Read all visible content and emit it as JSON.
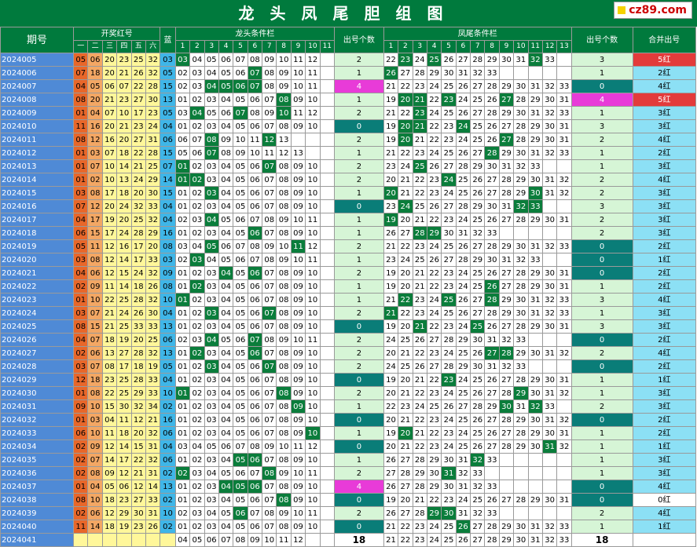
{
  "title": "龙头凤尾胆组图",
  "site": "cz89.com",
  "headers": {
    "period": "期号",
    "red": "开奖红号",
    "blue": "蓝",
    "head": "龙头条件栏",
    "count": "出号个数",
    "tail": "凤尾条件栏",
    "count2": "出号个数",
    "merge": "合并出号",
    "red_sub": [
      "一",
      "二",
      "三",
      "四",
      "五",
      "六"
    ],
    "head_sub": [
      "1",
      "2",
      "3",
      "4",
      "5",
      "6",
      "7",
      "8",
      "9",
      "10",
      "11"
    ],
    "tail_sub": [
      "1",
      "2",
      "3",
      "4",
      "5",
      "6",
      "7",
      "8",
      "9",
      "10",
      "11",
      "12",
      "13"
    ]
  },
  "rows": [
    {
      "p": "2024005",
      "red": [
        "05",
        "06",
        "20",
        "23",
        "25",
        "32"
      ],
      "b": "03",
      "hs": 3,
      "hh": [
        2,
        3
      ],
      "hc": "2",
      "ts": 22,
      "th": [
        23,
        25,
        32
      ],
      "tc": "3",
      "m": "5红",
      "mr": 1
    },
    {
      "p": "2024006",
      "red": [
        "07",
        "18",
        "20",
        "21",
        "26",
        "32"
      ],
      "b": "05",
      "hs": 2,
      "hh": [
        7
      ],
      "hc": "1",
      "ts": 26,
      "th": [
        26
      ],
      "tc": "1",
      "m": "2红"
    },
    {
      "p": "2024007",
      "red": [
        "04",
        "05",
        "06",
        "07",
        "22",
        "28"
      ],
      "b": "15",
      "hs": 2,
      "hh": [
        4,
        5,
        6,
        7
      ],
      "hc": "4",
      "ts": 21,
      "th": [],
      "tc": "0",
      "m": "4红"
    },
    {
      "p": "2024008",
      "red": [
        "08",
        "20",
        "21",
        "23",
        "27",
        "30"
      ],
      "b": "13",
      "hs": 1,
      "hh": [
        8
      ],
      "hc": "1",
      "ts": 19,
      "th": [
        20,
        21,
        23,
        27
      ],
      "tc": "4",
      "m": "5红",
      "mr": 1
    },
    {
      "p": "2024009",
      "red": [
        "01",
        "04",
        "07",
        "10",
        "17",
        "23"
      ],
      "b": "05",
      "hs": 3,
      "hh": [
        4,
        7,
        10
      ],
      "hc": "2",
      "ts": 21,
      "th": [
        23
      ],
      "tc": "1",
      "m": "3红"
    },
    {
      "p": "2024010",
      "red": [
        "11",
        "16",
        "20",
        "21",
        "23",
        "24"
      ],
      "b": "04",
      "hs": 1,
      "hh": [],
      "hc": "0",
      "ts": 19,
      "th": [
        20,
        21,
        24
      ],
      "tc": "3",
      "m": "3红"
    },
    {
      "p": "2024011",
      "red": [
        "08",
        "12",
        "16",
        "20",
        "27",
        "31"
      ],
      "b": "06",
      "hs": 6,
      "hh": [
        8,
        12
      ],
      "hc": "2",
      "ts": 19,
      "th": [
        20,
        27
      ],
      "tc": "2",
      "m": "4红"
    },
    {
      "p": "2024012",
      "red": [
        "01",
        "03",
        "07",
        "18",
        "22",
        "28"
      ],
      "b": "15",
      "hs": 5,
      "hh": [
        7
      ],
      "hc": "1",
      "ts": 21,
      "th": [
        28
      ],
      "tc": "1",
      "m": "2红"
    },
    {
      "p": "2024013",
      "red": [
        "01",
        "07",
        "10",
        "14",
        "21",
        "25"
      ],
      "b": "07",
      "hs": 1,
      "hh": [
        1,
        7
      ],
      "hc": "2",
      "ts": 23,
      "th": [
        25
      ],
      "tc": "1",
      "m": "3红"
    },
    {
      "p": "2024014",
      "red": [
        "01",
        "02",
        "10",
        "13",
        "24",
        "29"
      ],
      "b": "14",
      "hs": 1,
      "hh": [
        1,
        2
      ],
      "hc": "2",
      "ts": 20,
      "th": [
        24
      ],
      "tc": "2",
      "m": "4红"
    },
    {
      "p": "2024015",
      "red": [
        "03",
        "08",
        "17",
        "18",
        "20",
        "30"
      ],
      "b": "15",
      "hs": 1,
      "hh": [
        3
      ],
      "hc": "1",
      "ts": 20,
      "th": [
        20,
        30
      ],
      "tc": "2",
      "m": "3红"
    },
    {
      "p": "2024016",
      "red": [
        "07",
        "12",
        "20",
        "24",
        "32",
        "33"
      ],
      "b": "04",
      "hs": 1,
      "hh": [],
      "hc": "0",
      "ts": 23,
      "th": [
        24,
        32,
        33
      ],
      "tc": "3",
      "m": "3红"
    },
    {
      "p": "2024017",
      "red": [
        "04",
        "17",
        "19",
        "20",
        "25",
        "32"
      ],
      "b": "04",
      "hs": 2,
      "hh": [
        4
      ],
      "hc": "1",
      "ts": 19,
      "th": [
        19,
        32
      ],
      "tc": "2",
      "m": "3红"
    },
    {
      "p": "2024018",
      "red": [
        "06",
        "15",
        "17",
        "24",
        "28",
        "29"
      ],
      "b": "16",
      "hs": 1,
      "hh": [
        6
      ],
      "hc": "1",
      "ts": 26,
      "th": [
        28,
        29
      ],
      "tc": "2",
      "m": "3红"
    },
    {
      "p": "2024019",
      "red": [
        "05",
        "11",
        "12",
        "16",
        "17",
        "20"
      ],
      "b": "08",
      "hs": 3,
      "hh": [
        5,
        11
      ],
      "hc": "2",
      "ts": 21,
      "th": [],
      "tc": "0",
      "m": "2红"
    },
    {
      "p": "2024020",
      "red": [
        "03",
        "08",
        "12",
        "14",
        "17",
        "33"
      ],
      "b": "03",
      "hs": 2,
      "hh": [
        3
      ],
      "hc": "1",
      "ts": 23,
      "th": [],
      "tc": "0",
      "m": "1红"
    },
    {
      "p": "2024021",
      "red": [
        "04",
        "06",
        "12",
        "15",
        "24",
        "32"
      ],
      "b": "09",
      "hs": 1,
      "hh": [
        4,
        6
      ],
      "hc": "2",
      "ts": 19,
      "th": [],
      "tc": "0",
      "m": "2红"
    },
    {
      "p": "2024022",
      "red": [
        "02",
        "09",
        "11",
        "14",
        "18",
        "26"
      ],
      "b": "08",
      "hs": 1,
      "hh": [
        2
      ],
      "hc": "1",
      "ts": 19,
      "th": [
        26
      ],
      "tc": "1",
      "m": "2红"
    },
    {
      "p": "2024023",
      "red": [
        "01",
        "10",
        "22",
        "25",
        "28",
        "32"
      ],
      "b": "10",
      "hs": 1,
      "hh": [
        1
      ],
      "hc": "1",
      "ts": 21,
      "th": [
        22,
        25,
        28
      ],
      "tc": "3",
      "m": "4红"
    },
    {
      "p": "2024024",
      "red": [
        "03",
        "07",
        "21",
        "24",
        "26",
        "30"
      ],
      "b": "04",
      "hs": 1,
      "hh": [
        3,
        7
      ],
      "hc": "2",
      "ts": 21,
      "th": [
        21
      ],
      "tc": "1",
      "m": "3红"
    },
    {
      "p": "2024025",
      "red": [
        "08",
        "15",
        "21",
        "25",
        "33",
        "33"
      ],
      "b": "13",
      "hs": 1,
      "hh": [],
      "hc": "0",
      "ts": 19,
      "th": [
        21,
        25,
        33
      ],
      "tc": "3",
      "m": "3红"
    },
    {
      "p": "2024026",
      "red": [
        "04",
        "07",
        "18",
        "19",
        "20",
        "25"
      ],
      "b": "06",
      "hs": 2,
      "hh": [
        4,
        7
      ],
      "hc": "2",
      "ts": 24,
      "th": [],
      "tc": "0",
      "m": "2红"
    },
    {
      "p": "2024027",
      "red": [
        "02",
        "06",
        "13",
        "27",
        "28",
        "32"
      ],
      "b": "13",
      "hs": 1,
      "hh": [
        2,
        6
      ],
      "hc": "2",
      "ts": 20,
      "th": [
        27,
        28
      ],
      "tc": "2",
      "m": "4红"
    },
    {
      "p": "2024028",
      "red": [
        "03",
        "07",
        "08",
        "17",
        "18",
        "19"
      ],
      "b": "05",
      "hs": 1,
      "hh": [
        3,
        7
      ],
      "hc": "2",
      "ts": 24,
      "th": [],
      "tc": "0",
      "m": "2红"
    },
    {
      "p": "2024029",
      "red": [
        "12",
        "18",
        "23",
        "25",
        "28",
        "33"
      ],
      "b": "04",
      "hs": 1,
      "hh": [],
      "hc": "0",
      "ts": 19,
      "th": [
        23
      ],
      "tc": "1",
      "m": "1红"
    },
    {
      "p": "2024030",
      "red": [
        "01",
        "08",
        "22",
        "25",
        "29",
        "33"
      ],
      "b": "10",
      "hs": 1,
      "hh": [
        1,
        8
      ],
      "hc": "2",
      "ts": 20,
      "th": [
        29
      ],
      "tc": "1",
      "m": "3红"
    },
    {
      "p": "2024031",
      "red": [
        "09",
        "10",
        "15",
        "30",
        "32",
        "34"
      ],
      "b": "02",
      "hs": 1,
      "hh": [
        9
      ],
      "hc": "1",
      "ts": 22,
      "th": [
        30,
        32
      ],
      "tc": "2",
      "m": "3红"
    },
    {
      "p": "2024032",
      "red": [
        "01",
        "03",
        "04",
        "11",
        "12",
        "21"
      ],
      "b": "16",
      "hs": 1,
      "hh": [],
      "hc": "0",
      "ts": 20,
      "th": [],
      "tc": "0",
      "m": "2红"
    },
    {
      "p": "2024033",
      "red": [
        "06",
        "10",
        "11",
        "18",
        "20",
        "32"
      ],
      "b": "06",
      "hs": 1,
      "hh": [
        10
      ],
      "hc": "1",
      "ts": 19,
      "th": [
        20
      ],
      "tc": "1",
      "m": "2红"
    },
    {
      "p": "2024034",
      "red": [
        "02",
        "09",
        "12",
        "14",
        "15",
        "31"
      ],
      "b": "04",
      "hs": 3,
      "hh": [],
      "hc": "0",
      "ts": 20,
      "th": [
        31
      ],
      "tc": "1",
      "m": "1红"
    },
    {
      "p": "2024035",
      "red": [
        "02",
        "07",
        "14",
        "17",
        "22",
        "32"
      ],
      "b": "06",
      "hs": 1,
      "hh": [
        5,
        6
      ],
      "hc": "1",
      "ts": 26,
      "th": [
        32
      ],
      "tc": "1",
      "m": "3红"
    },
    {
      "p": "2024036",
      "red": [
        "02",
        "08",
        "09",
        "12",
        "21",
        "31"
      ],
      "b": "02",
      "hs": 2,
      "hh": [
        2,
        8
      ],
      "hc": "2",
      "ts": 27,
      "th": [
        31
      ],
      "tc": "1",
      "m": "3红"
    },
    {
      "p": "2024037",
      "red": [
        "01",
        "04",
        "05",
        "06",
        "12",
        "14"
      ],
      "b": "13",
      "hs": 1,
      "hh": [
        4,
        5,
        6
      ],
      "hc": "4",
      "ts": 26,
      "th": [],
      "tc": "0",
      "m": "4红"
    },
    {
      "p": "2024038",
      "red": [
        "08",
        "10",
        "18",
        "23",
        "27",
        "33"
      ],
      "b": "02",
      "hs": 1,
      "hh": [
        8
      ],
      "hc": "0",
      "ts": 19,
      "th": [],
      "tc": "0",
      "m": "0红"
    },
    {
      "p": "2024039",
      "red": [
        "02",
        "06",
        "12",
        "29",
        "30",
        "31"
      ],
      "b": "10",
      "hs": 2,
      "hh": [
        6
      ],
      "hc": "2",
      "ts": 26,
      "th": [
        29,
        30
      ],
      "tc": "2",
      "m": "4红"
    },
    {
      "p": "2024040",
      "red": [
        "11",
        "14",
        "18",
        "19",
        "23",
        "26"
      ],
      "b": "02",
      "hs": 1,
      "hh": [],
      "hc": "0",
      "ts": 21,
      "th": [
        26
      ],
      "tc": "1",
      "m": "1红"
    },
    {
      "p": "2024041",
      "red": [
        "",
        "",
        "",
        "",
        "",
        ""
      ],
      "b": "",
      "hs": 4,
      "hh": [],
      "hc": "18",
      "ts": 21,
      "th": [],
      "tc": "18",
      "m": "",
      "last": 1
    }
  ]
}
